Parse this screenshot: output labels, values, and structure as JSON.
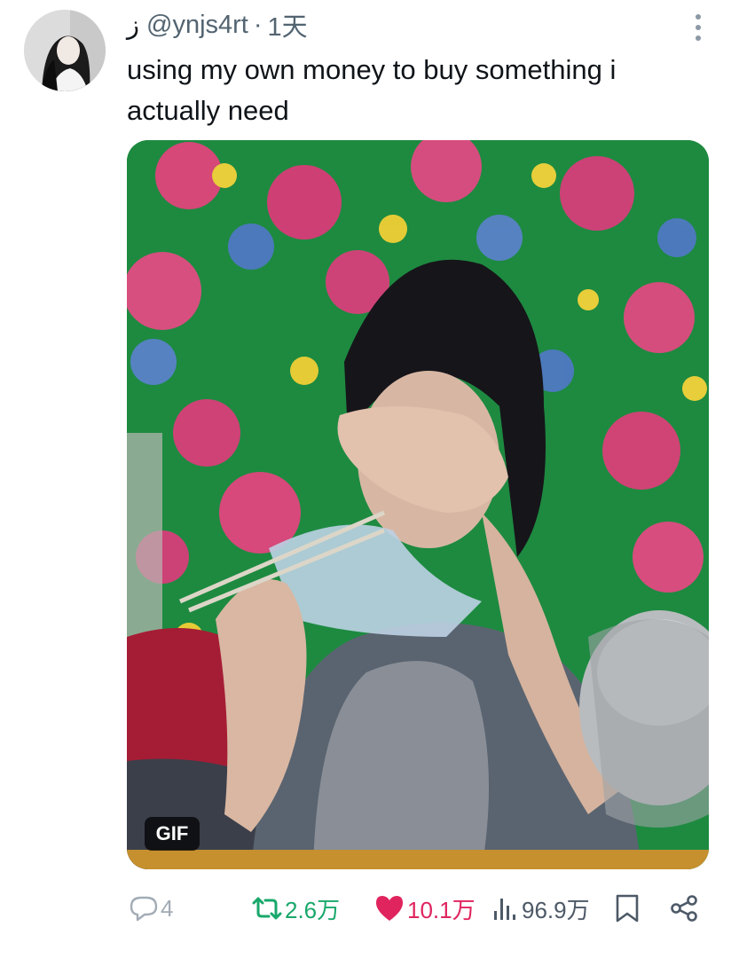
{
  "tweet": {
    "display_name": "ز",
    "handle": "@ynjs4rt",
    "separator": "·",
    "timestamp": "1天",
    "text": "using my own money to buy something i actually need",
    "media": {
      "badge": "GIF"
    }
  },
  "actions": {
    "reply_count": "4",
    "retweet_count": "2.6万",
    "like_count": "10.1万",
    "view_count": "96.9万"
  },
  "colors": {
    "retweet": "#18a86b",
    "like": "#e0245e",
    "muted": "#a3acb5"
  }
}
